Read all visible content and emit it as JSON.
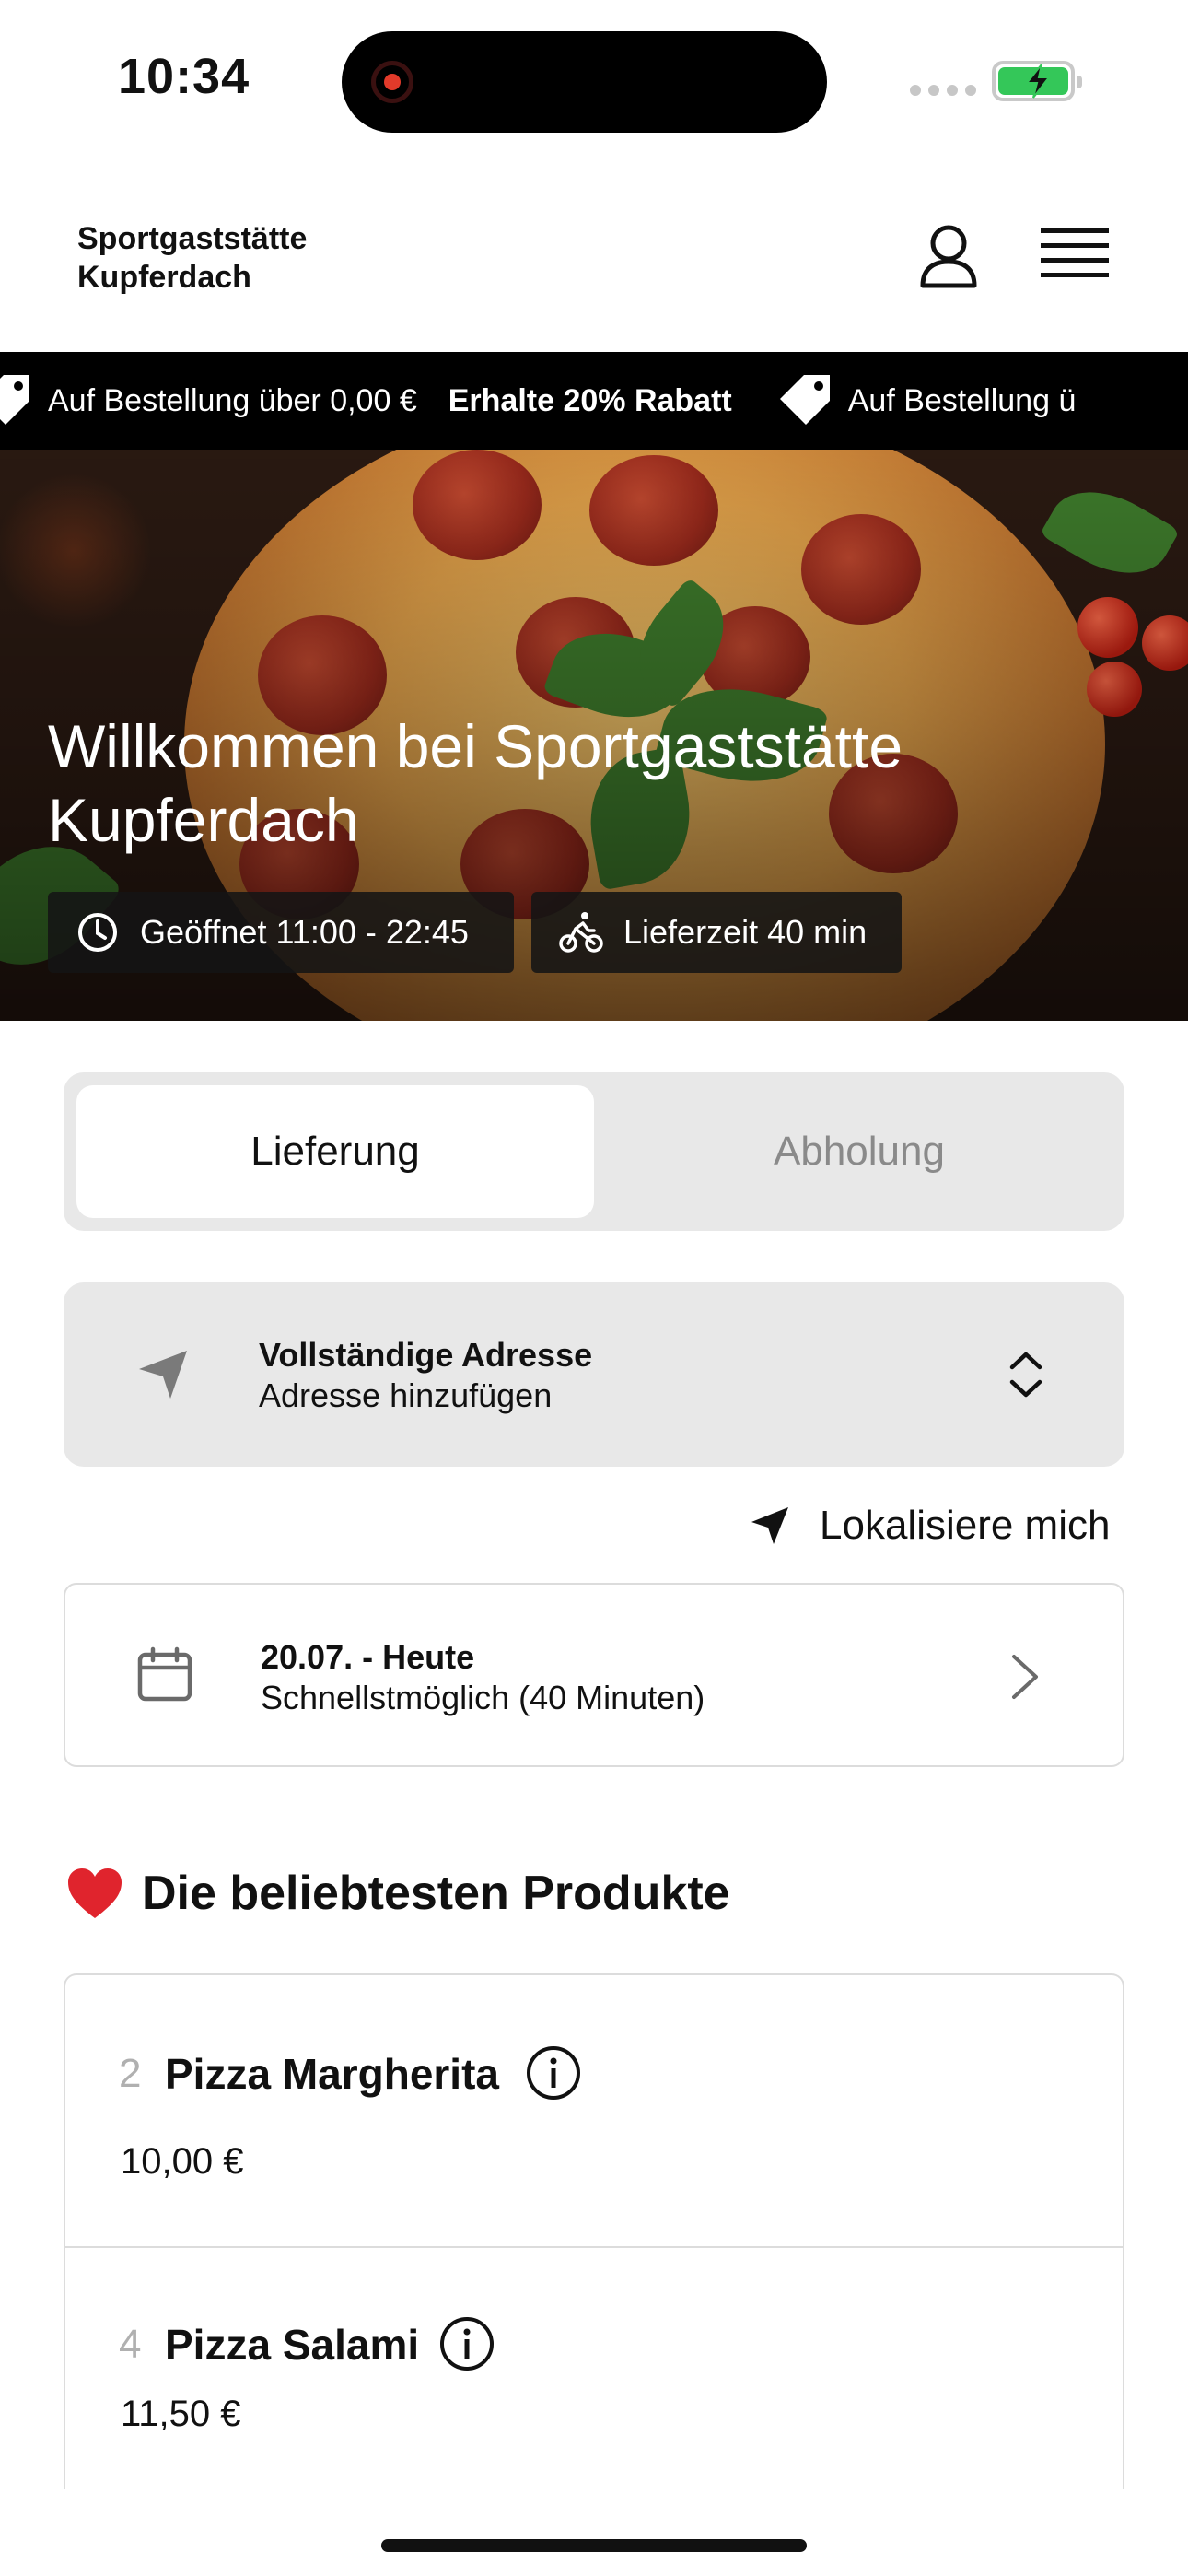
{
  "status_bar": {
    "time": "10:34"
  },
  "header": {
    "brand": "Sportgaststätte Kupferdach"
  },
  "promo": {
    "items": [
      "Auf Bestellung über 0,00 €",
      "Erhalte 20% Rabatt",
      "Auf Bestellung ü"
    ]
  },
  "hero": {
    "title": "Willkommen bei Sportgaststätte Kupferdach",
    "opening_hours": "Geöffnet 11:00 - 22:45",
    "delivery_time": "Lieferzeit 40 min"
  },
  "order_type": {
    "delivery_label": "Lieferung",
    "pickup_label": "Abholung",
    "selected": "Lieferung"
  },
  "address": {
    "title": "Vollständige Adresse",
    "placeholder": "Adresse hinzufügen"
  },
  "locate": {
    "label": "Lokalisiere mich"
  },
  "schedule": {
    "date": "20.07. - Heute",
    "time": "Schnellstmöglich (40 Minuten)"
  },
  "popular": {
    "title": "Die beliebtesten Produkte",
    "products": [
      {
        "number": "2",
        "name": "Pizza Margherita",
        "price": "10,00 €"
      },
      {
        "number": "4",
        "name": "Pizza Salami",
        "price": "11,50 €"
      }
    ]
  },
  "colors": {
    "accent": "#000000",
    "promo_bg": "#000000",
    "card_bg": "#e8e8e8",
    "battery": "#34c759",
    "heart": "#e0242d"
  }
}
